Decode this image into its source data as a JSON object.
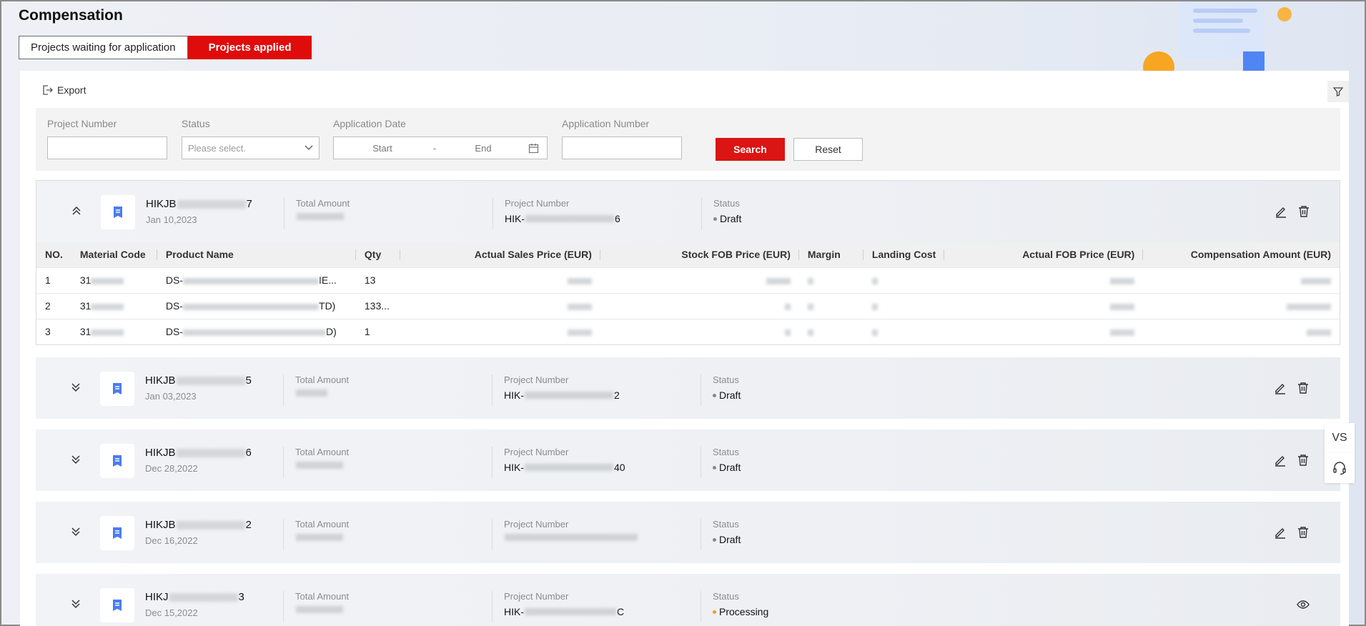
{
  "page": {
    "title": "Compensation"
  },
  "tabs": [
    {
      "label": "Projects waiting for application"
    },
    {
      "label": "Projects applied"
    }
  ],
  "toolbar": {
    "export_label": "Export"
  },
  "filters": {
    "project_number": {
      "label": "Project Number",
      "value": ""
    },
    "status": {
      "label": "Status",
      "placeholder": "Please select."
    },
    "application_date": {
      "label": "Application Date",
      "start": "Start",
      "separator": "-",
      "end": "End"
    },
    "application_number": {
      "label": "Application Number",
      "value": ""
    },
    "search_label": "Search",
    "reset_label": "Reset"
  },
  "card_labels": {
    "total_amount": "Total Amount",
    "project_number": "Project Number",
    "status": "Status"
  },
  "projects": [
    {
      "id_prefix": "HIKJB",
      "id_suffix": "7",
      "date": "Jan 10,2023",
      "project_prefix": "HIK-",
      "project_suffix": "6",
      "status": "Draft"
    },
    {
      "id_prefix": "HIKJB",
      "id_suffix": "5",
      "date": "Jan 03,2023",
      "project_prefix": "HIK-",
      "project_suffix": "2",
      "status": "Draft"
    },
    {
      "id_prefix": "HIKJB",
      "id_suffix": "6",
      "date": "Dec 28,2022",
      "project_prefix": "HIK-",
      "project_suffix": "40",
      "status": "Draft"
    },
    {
      "id_prefix": "HIKJB",
      "id_suffix": "2",
      "date": "Dec 16,2022",
      "project_prefix": "",
      "project_suffix": "",
      "status": "Draft"
    },
    {
      "id_prefix": "HIKJ",
      "id_suffix": "3",
      "date": "Dec 15,2022",
      "project_prefix": "HIK-",
      "project_suffix": "C",
      "status": "Processing"
    }
  ],
  "detail_table": {
    "headers": [
      "NO.",
      "Material Code",
      "Product Name",
      "Qty",
      "Actual Sales Price (EUR)",
      "Stock FOB Price (EUR)",
      "Margin",
      "Landing Cost",
      "Actual FOB Price (EUR)",
      "Compensation Amount (EUR)"
    ],
    "rows": [
      {
        "no": "1",
        "material_prefix": "31",
        "product_prefix": "DS-",
        "product_suffix": "IE...",
        "qty": "13"
      },
      {
        "no": "2",
        "material_prefix": "31",
        "product_prefix": "DS-",
        "product_suffix": "TD)",
        "qty": "133..."
      },
      {
        "no": "3",
        "material_prefix": "31",
        "product_prefix": "DS-",
        "product_suffix": "D)",
        "qty": "1"
      }
    ]
  },
  "side": {
    "vs_label": "VS"
  },
  "colors": {
    "accent": "#e00c0c",
    "icon_blue": "#4a7cf0",
    "draft_dot": "#888888",
    "processing_dot": "#f59a23"
  }
}
